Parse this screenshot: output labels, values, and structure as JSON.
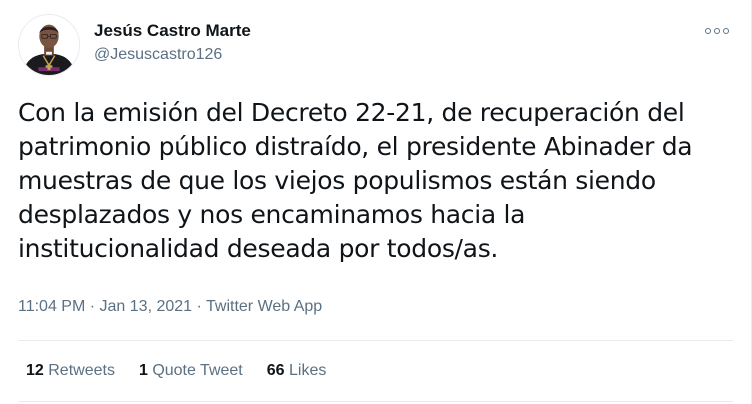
{
  "author": {
    "display_name": "Jesús Castro Marte",
    "handle": "@Jesuscastro126"
  },
  "menu": {
    "icon": "more-icon"
  },
  "tweet": {
    "text": "Con la emisión del Decreto 22-21, de recuperación del patrimonio público distraído, el presidente Abinader da muestras de que los viejos populismos están siendo desplazados y nos encaminamos hacia la institucionalidad deseada por todos/as.",
    "time": "11:04 PM",
    "date": "Jan 13, 2021",
    "separator": "·",
    "source": "Twitter Web App"
  },
  "stats": [
    {
      "count": "12",
      "label": "Retweets"
    },
    {
      "count": "1",
      "label": "Quote Tweet"
    },
    {
      "count": "66",
      "label": "Likes"
    }
  ],
  "colors": {
    "text_primary": "#0f1419",
    "text_secondary": "#5b7083",
    "divider": "#e6ecf0"
  }
}
